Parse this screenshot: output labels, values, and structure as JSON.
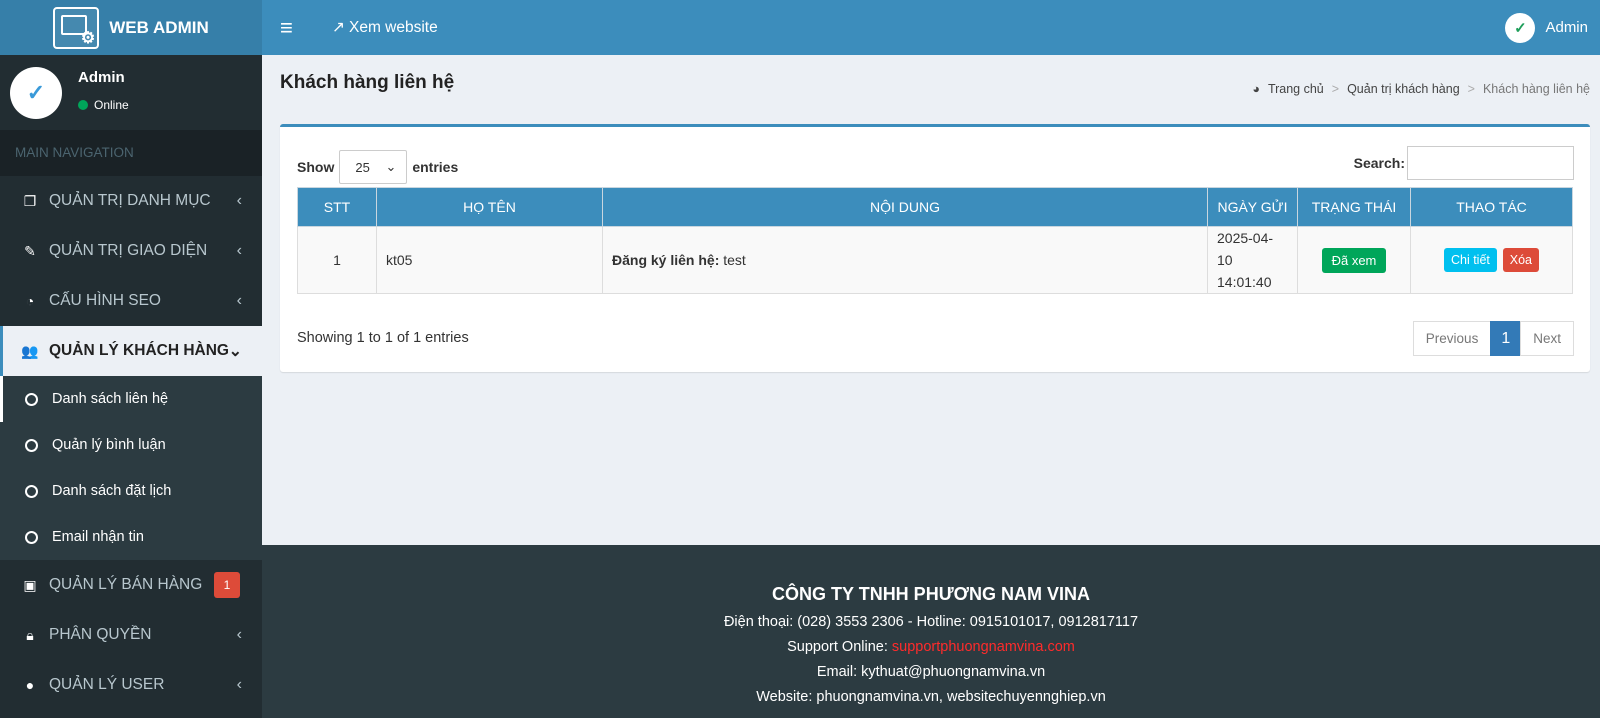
{
  "app": {
    "logo_text": "WEB ADMIN",
    "view_site": "Xem website",
    "user_name": "Admin"
  },
  "user_panel": {
    "name": "Admin",
    "status": "Online"
  },
  "sidebar": {
    "header": "MAIN NAVIGATION",
    "items": [
      {
        "label": "QUẢN TRỊ DANH MỤC",
        "icon": "copy-icon"
      },
      {
        "label": "QUẢN TRỊ GIAO DIỆN",
        "icon": "magic-wand-icon"
      },
      {
        "label": "CẤU HÌNH SEO",
        "icon": "dashboard-icon"
      },
      {
        "label": "QUẢN LÝ KHÁCH HÀNG",
        "icon": "users-icon"
      },
      {
        "label": "QUẢN LÝ BÁN HÀNG",
        "icon": "money-icon",
        "badge": "1"
      },
      {
        "label": "PHÂN QUYỀN",
        "icon": "lock-icon"
      },
      {
        "label": "QUẢN LÝ USER",
        "icon": "user-icon"
      }
    ],
    "sub_items": [
      "Danh sách liên hệ",
      "Quản lý bình luận",
      "Danh sách đặt lịch",
      "Email nhận tin"
    ]
  },
  "page": {
    "title": "Khách hàng liên hệ",
    "breadcrumb": [
      "Trang chủ",
      "Quản trị khách hàng",
      "Khách hàng liên hệ"
    ]
  },
  "table_controls": {
    "show": "Show",
    "entries_value": "25",
    "entries": "entries",
    "search_label": "Search:",
    "search_value": ""
  },
  "table": {
    "headers": [
      "STT",
      "HỌ TÊN",
      "NỘI DUNG",
      "NGÀY GỬI",
      "TRẠNG THÁI",
      "THAO TÁC"
    ],
    "rows": [
      {
        "stt": "1",
        "name": "kt05",
        "content_label": "Đăng ký liên hệ:",
        "content_value": "test",
        "date": "2025-04-10",
        "time": "14:01:40",
        "status": "Đã xem",
        "detail": "Chi tiết",
        "delete": "Xóa"
      }
    ]
  },
  "pagination": {
    "info": "Showing 1 to 1 of 1 entries",
    "previous": "Previous",
    "current": "1",
    "next": "Next"
  },
  "footer": {
    "company": "CÔNG TY TNHH PHƯƠNG NAM VINA",
    "phone": "Điện thoại: (028) 3553 2306 - Hotline: 0915101017, 0912817117",
    "support_label": "Support Online:",
    "support_value": "supportphuongnamvina.com",
    "email": "Email: kythuat@phuongnamvina.vn",
    "website": "Website: phuongnamvina.vn, websitechuyennghiep.vn"
  },
  "colors": {
    "topbar": "#3c8dbc",
    "sidebar": "#222d32",
    "success": "#00a65a",
    "danger": "#dd4b39",
    "info": "#00c0ef"
  }
}
